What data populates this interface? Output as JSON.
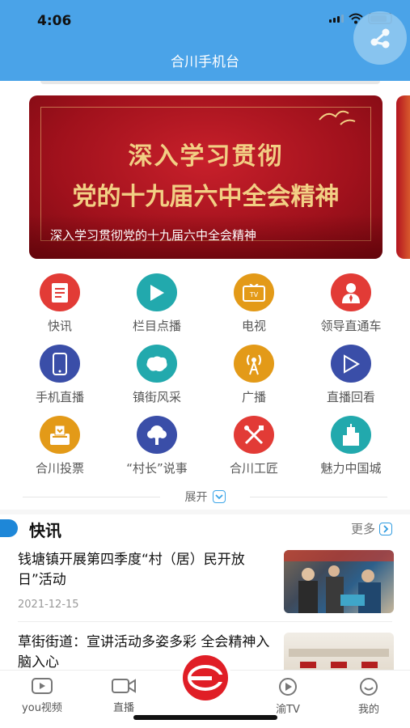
{
  "status_bar": {
    "time": "4:06"
  },
  "header": {
    "title": "合川手机台",
    "share_icon": "share-icon"
  },
  "banner": {
    "line1": "深入学习贯彻",
    "line2": "党的十九届六中全会精神",
    "caption": "深入学习贯彻党的十九届六中全会精神"
  },
  "grid": {
    "items": [
      {
        "label": "快讯",
        "icon": "document-icon",
        "color": "#e23b36"
      },
      {
        "label": "栏目点播",
        "icon": "play-icon",
        "color": "#22a9ad"
      },
      {
        "label": "电视",
        "icon": "tv-icon",
        "color": "#e39a18"
      },
      {
        "label": "领导直通车",
        "icon": "person-icon",
        "color": "#e23b36"
      },
      {
        "label": "手机直播",
        "icon": "phone-icon",
        "color": "#3a4ea8"
      },
      {
        "label": "镇街风采",
        "icon": "map-icon",
        "color": "#22a9ad"
      },
      {
        "label": "广播",
        "icon": "antenna-icon",
        "color": "#e39a18"
      },
      {
        "label": "直播回看",
        "icon": "replay-icon",
        "color": "#3a4ea8"
      },
      {
        "label": "合川投票",
        "icon": "ballot-icon",
        "color": "#e39a18"
      },
      {
        "label": "“村长”说事",
        "icon": "tree-icon",
        "color": "#3a4ea8"
      },
      {
        "label": "合川工匠",
        "icon": "tools-icon",
        "color": "#e23b36"
      },
      {
        "label": "魅力中国城",
        "icon": "building-icon",
        "color": "#22a9ad"
      }
    ]
  },
  "expand": {
    "label": "展开"
  },
  "news_section": {
    "title": "快讯",
    "more": "更多",
    "items": [
      {
        "title": "钱塘镇开展第四季度“村（居）民开放日”活动",
        "date": "2021-12-15"
      },
      {
        "title": "草街街道：宣讲活动多姿多彩 全会精神入脑入心",
        "date": ""
      }
    ]
  },
  "tabbar": {
    "items": [
      {
        "label": "you视频",
        "icon": "video-icon"
      },
      {
        "label": "直播",
        "icon": "camera-icon"
      },
      {
        "label": "渝TV",
        "icon": "tv-play-icon"
      },
      {
        "label": "我的",
        "icon": "smile-icon"
      }
    ],
    "center_icon": "station-logo-icon"
  }
}
